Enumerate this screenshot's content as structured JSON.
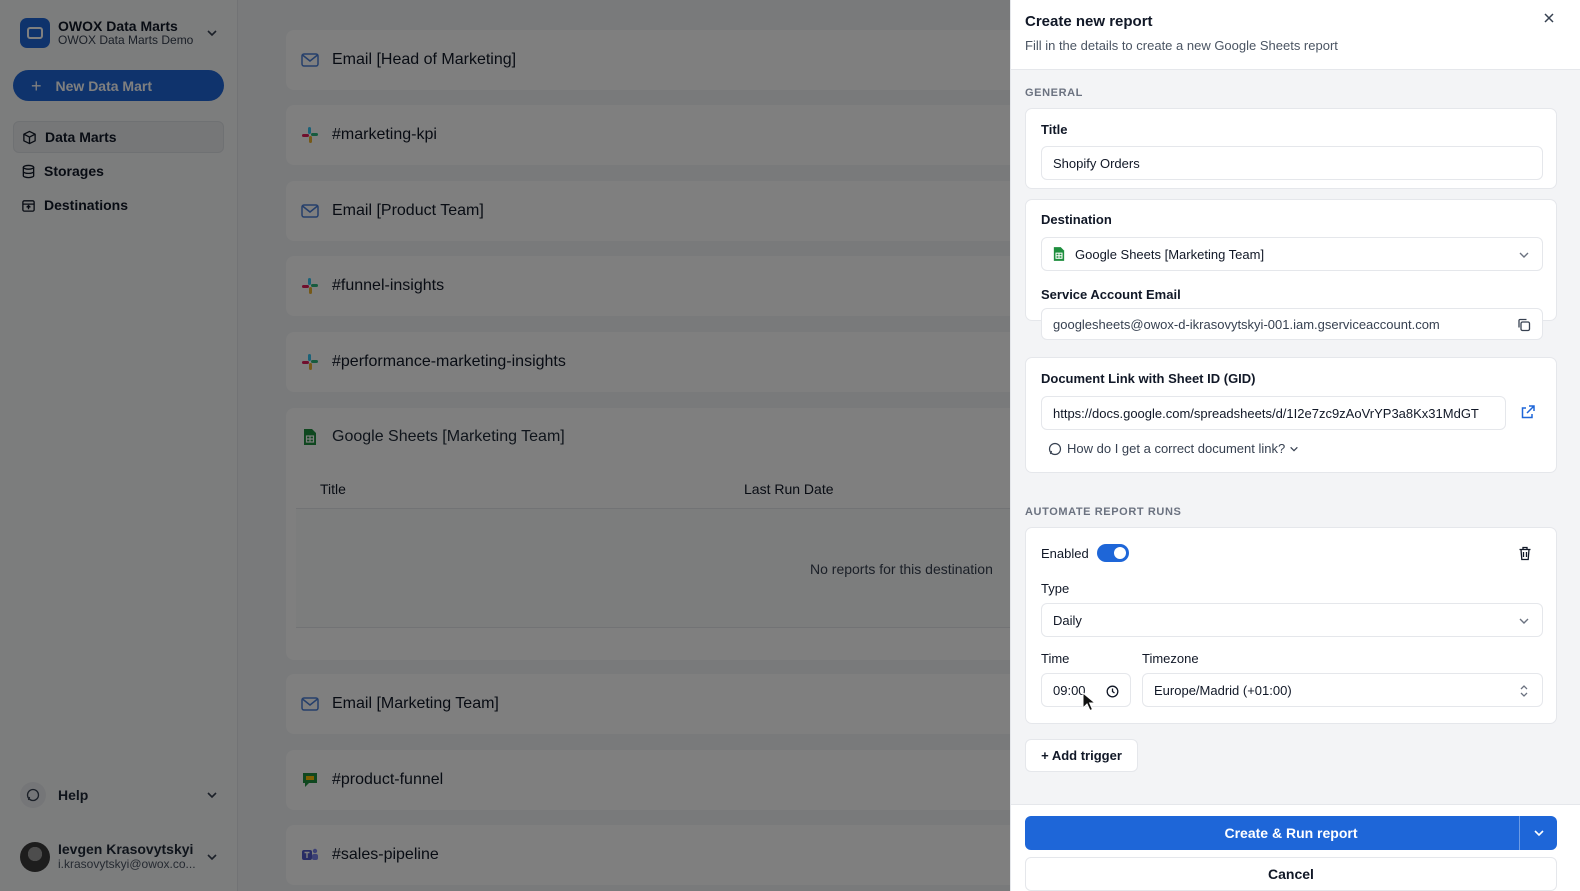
{
  "sidebar": {
    "workspace_name": "OWOX Data Marts",
    "workspace_sub": "OWOX Data Marts Demo",
    "new_button": "New Data Mart",
    "nav": [
      {
        "label": "Data Marts",
        "icon": "cube-icon",
        "active": true
      },
      {
        "label": "Storages",
        "icon": "database-icon",
        "active": false
      },
      {
        "label": "Destinations",
        "icon": "destination-icon",
        "active": false
      }
    ],
    "help": "Help",
    "user_name": "Ievgen Krasovytskyi",
    "user_email": "i.krasovytskyi@owox.co..."
  },
  "main": {
    "destinations": [
      {
        "name": "Email [Head of Marketing]",
        "icon": "mail-icon"
      },
      {
        "name": "#marketing-kpi",
        "icon": "slack-icon"
      },
      {
        "name": "Email [Product Team]",
        "icon": "mail-icon"
      },
      {
        "name": "#funnel-insights",
        "icon": "slack-icon"
      },
      {
        "name": "#performance-marketing-insights",
        "icon": "slack-icon"
      },
      {
        "name": "Google Sheets [Marketing Team]",
        "icon": "google-sheets-icon"
      },
      {
        "name": "Email [Marketing Team]",
        "icon": "mail-icon"
      },
      {
        "name": "#product-funnel",
        "icon": "google-chat-icon"
      },
      {
        "name": "#sales-pipeline",
        "icon": "teams-icon"
      }
    ],
    "table_col_title": "Title",
    "table_col_last_run": "Last Run Date",
    "empty_text": "No reports for this destination"
  },
  "drawer": {
    "title": "Create new report",
    "subtitle": "Fill in the details to create a new Google Sheets report",
    "section_general": "GENERAL",
    "title_label": "Title",
    "title_value": "Shopify Orders",
    "destination_label": "Destination",
    "destination_value": "Google Sheets [Marketing Team]",
    "service_email_label": "Service Account Email",
    "service_email_value": "googlesheets@owox-d-ikrasovytskyi-001.iam.gserviceaccount.com",
    "doc_link_label": "Document Link with Sheet ID (GID)",
    "doc_link_value": "https://docs.google.com/spreadsheets/d/1I2e7zc9zAoVrYP3a8Kx31MdGT",
    "doc_link_hint": "How do I get a correct document link?",
    "section_automate": "AUTOMATE REPORT RUNS",
    "enabled_label": "Enabled",
    "enabled": true,
    "type_label": "Type",
    "type_value": "Daily",
    "time_label": "Time",
    "time_value": "09:00",
    "timezone_label": "Timezone",
    "timezone_value": "Europe/Madrid (+01:00)",
    "add_trigger": "+ Add trigger",
    "primary_button": "Create & Run report",
    "cancel_button": "Cancel"
  },
  "colors": {
    "accent": "#1e66d8",
    "sheets_green": "#1e8e3e"
  }
}
